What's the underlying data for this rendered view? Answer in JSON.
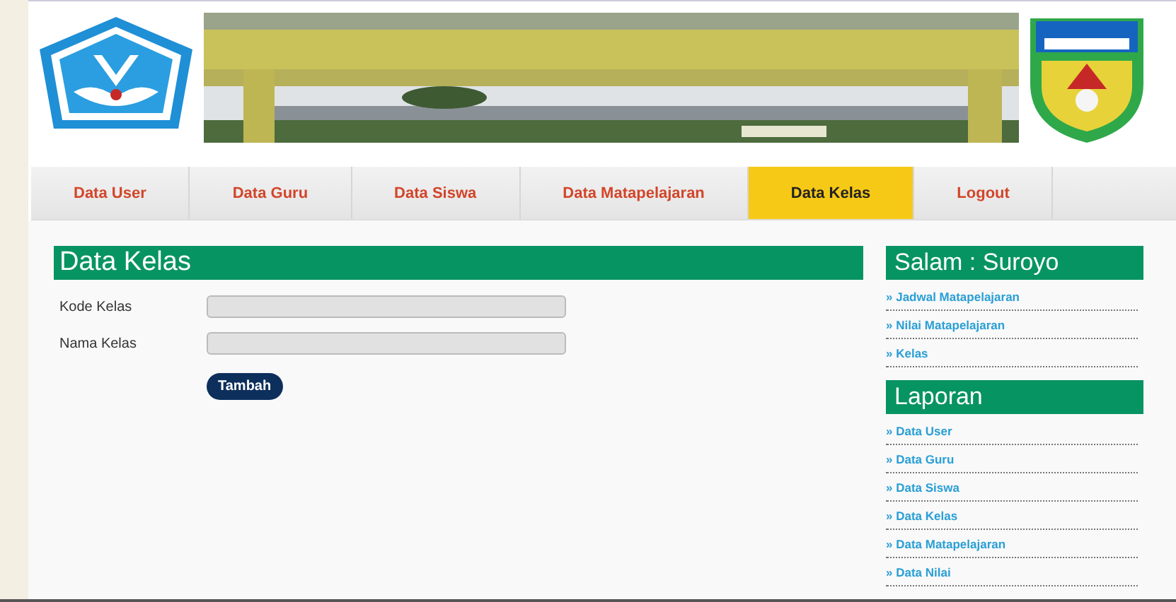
{
  "nav": [
    {
      "label": "Data User",
      "selected": false
    },
    {
      "label": "Data Guru",
      "selected": false
    },
    {
      "label": "Data Siswa",
      "selected": false
    },
    {
      "label": "Data Matapelajaran",
      "selected": false
    },
    {
      "label": "Data Kelas",
      "selected": true
    },
    {
      "label": "Logout",
      "selected": false
    }
  ],
  "form": {
    "title": "Data Kelas",
    "fields": [
      {
        "label": "Kode Kelas"
      },
      {
        "label": "Nama Kelas"
      }
    ],
    "button": "Tambah"
  },
  "sidebar": [
    {
      "title": "Salam : Suroyo",
      "links": [
        "» Jadwal Matapelajaran",
        "» Nilai Matapelajaran",
        "» Kelas"
      ]
    },
    {
      "title": "Laporan",
      "links": [
        "» Data User",
        "» Data Guru",
        "» Data Siswa",
        "» Data Kelas",
        "» Data Matapelajaran",
        "» Data Nilai"
      ]
    }
  ]
}
